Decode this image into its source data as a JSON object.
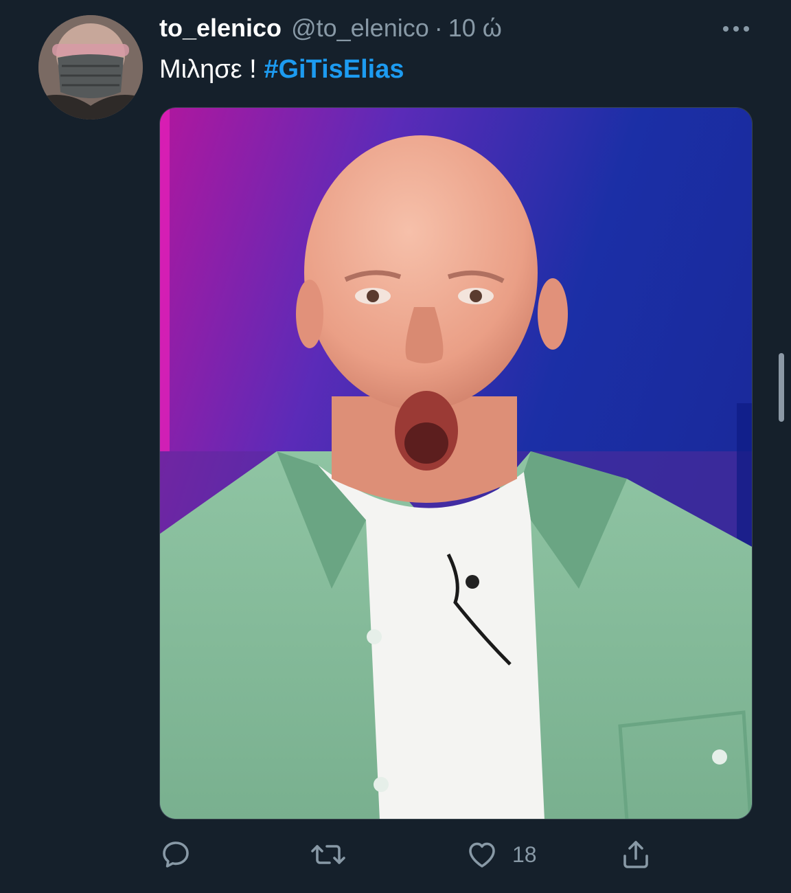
{
  "tweet": {
    "display_name": "to_elenico",
    "handle": "@to_elenico",
    "separator": "·",
    "time": "10 ώ",
    "text": "Μιλησε !",
    "hashtag": "#GiTisElias"
  },
  "actions": {
    "like_count": "18"
  },
  "colors": {
    "background": "#15202b",
    "secondary_text": "#8899a6",
    "hashtag": "#1d9bf0"
  },
  "icons": [
    "more-options-icon",
    "reply-icon",
    "retweet-icon",
    "like-icon",
    "share-icon"
  ]
}
